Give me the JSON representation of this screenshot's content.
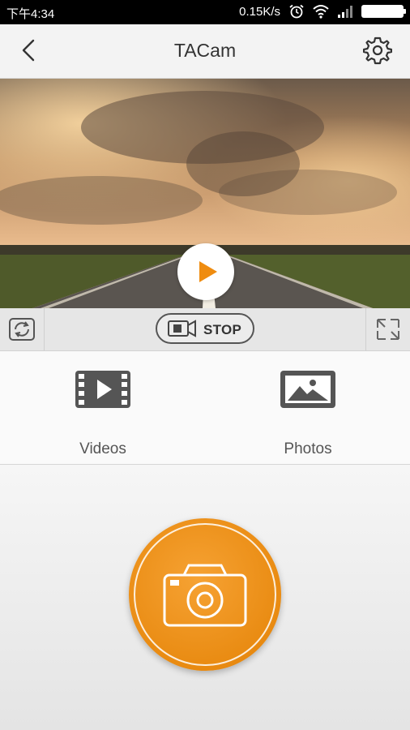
{
  "status_bar": {
    "time": "下午4:34",
    "speed": "0.15K/s",
    "icons": [
      "alarm-icon",
      "wifi-icon",
      "signal-icon",
      "battery-icon"
    ]
  },
  "header": {
    "title": "TACam",
    "back_icon": "chevron-left-icon",
    "settings_icon": "gear-icon"
  },
  "video": {
    "play_icon": "play-icon"
  },
  "controls": {
    "rotate_icon": "rotate-camera-icon",
    "stop_label": "STOP",
    "fullscreen_icon": "expand-icon"
  },
  "media": {
    "videos_label": "Videos",
    "photos_label": "Photos"
  },
  "shutter": {
    "icon": "camera-icon"
  },
  "colors": {
    "accent": "#ef8c10",
    "header_bg": "#f3f3f3",
    "text": "#333333"
  }
}
